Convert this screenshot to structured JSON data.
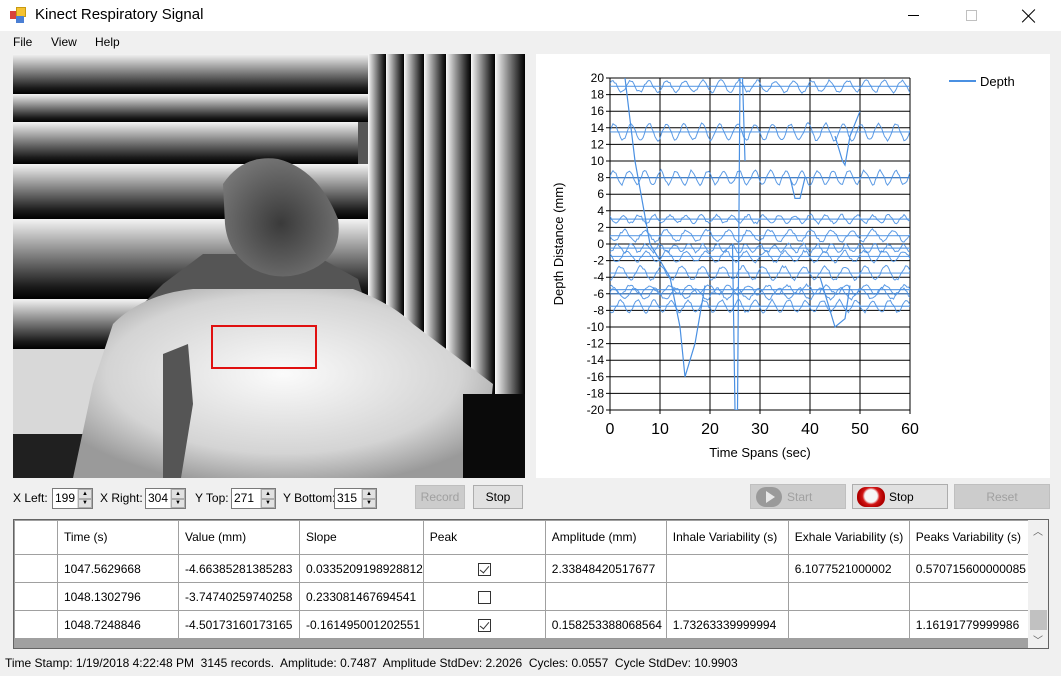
{
  "window": {
    "title": "Kinect Respiratory Signal",
    "controls": {
      "minimize": "minimize",
      "maximize": "maximize",
      "close": "close"
    }
  },
  "menu": [
    "File",
    "View",
    "Help"
  ],
  "depth_view": {
    "roi_color": "#e01010"
  },
  "roi_controls": {
    "x_left_label": "X Left:",
    "x_left": "199",
    "x_right_label": "X Right:",
    "x_right": "304",
    "y_top_label": "Y Top:",
    "y_top": "271",
    "y_bottom_label": "Y Bottom:",
    "y_bottom": "315",
    "record_label": "Record",
    "stop_label": "Stop"
  },
  "recording_controls": {
    "start_label": "Start",
    "stop_label": "Stop",
    "reset_label": "Reset"
  },
  "chart_data": {
    "type": "line",
    "title": "",
    "xlabel": "Time Spans (sec)",
    "ylabel": "Depth Distance (mm)",
    "xlim": [
      0,
      60
    ],
    "ylim": [
      -20,
      20
    ],
    "xticks": [
      0,
      10,
      20,
      30,
      40,
      50,
      60
    ],
    "yticks": [
      20,
      18,
      16,
      14,
      12,
      10,
      8,
      6,
      4,
      2,
      0,
      -2,
      -4,
      -6,
      -8,
      -10,
      -12,
      -14,
      -16,
      -18,
      -20
    ],
    "grid": true,
    "legend": {
      "position": "top-right",
      "entries": [
        "Depth"
      ]
    },
    "series_color": "#4a90e2",
    "series": [
      {
        "name": "Depth",
        "note": "many overlaid oscillating traces with baselines near these levels",
        "baselines": [
          19,
          13.5,
          8,
          3,
          1,
          -0.5,
          -1.5,
          -3.5,
          -5.5,
          -6,
          -7.5
        ],
        "spikes": [
          {
            "x": [
              3,
              5,
              8,
              12,
              14,
              15,
              17,
              19
            ],
            "y": [
              20,
              10,
              0,
              -4,
              -10,
              -16,
              -12,
              -5
            ]
          },
          {
            "x": [
              24.5,
              25,
              25.5,
              26,
              26.5,
              27
            ],
            "y": [
              0,
              -20,
              -20,
              20,
              20,
              10
            ]
          },
          {
            "x": [
              36,
              37,
              38,
              39
            ],
            "y": [
              8,
              5.5,
              5.5,
              8
            ]
          },
          {
            "x": [
              45,
              46.5,
              47,
              48,
              50
            ],
            "y": [
              13,
              10,
              9.5,
              13,
              16
            ]
          },
          {
            "x": [
              42,
              45,
              47,
              48
            ],
            "y": [
              -4,
              -10,
              -9,
              -5
            ]
          }
        ]
      }
    ]
  },
  "table": {
    "columns": [
      "Time (s)",
      "Value (mm)",
      "Slope",
      "Peak",
      "Amplitude (mm)",
      "Inhale Variability (s)",
      "Exhale Variability (s)",
      "Peaks Variability (s)"
    ],
    "rows": [
      {
        "time": "1047.5629668",
        "value": "-4.66385281385283",
        "slope": "0.0335209198928812",
        "peak": true,
        "amplitude": "2.33848420517677",
        "inhale": "",
        "exhale": "6.1077521000002",
        "peaks": "0.570715600000085"
      },
      {
        "time": "1048.1302796",
        "value": "-3.74740259740258",
        "slope": "0.233081467694541",
        "peak": false,
        "amplitude": "",
        "inhale": "",
        "exhale": "",
        "peaks": ""
      },
      {
        "time": "1048.7248846",
        "value": "-4.50173160173165",
        "slope": "-0.161495001202551",
        "peak": true,
        "amplitude": "0.158253388068564",
        "inhale": "1.73263339999994",
        "exhale": "",
        "peaks": "1.16191779999986"
      }
    ]
  },
  "status": {
    "text": "Time Stamp: 1/19/2018 4:22:48 PM  3145 records.  Amplitude: 0.7487  Amplitude StdDev: 2.2026  Cycles: 0.0557  Cycle StdDev: 10.9903"
  }
}
